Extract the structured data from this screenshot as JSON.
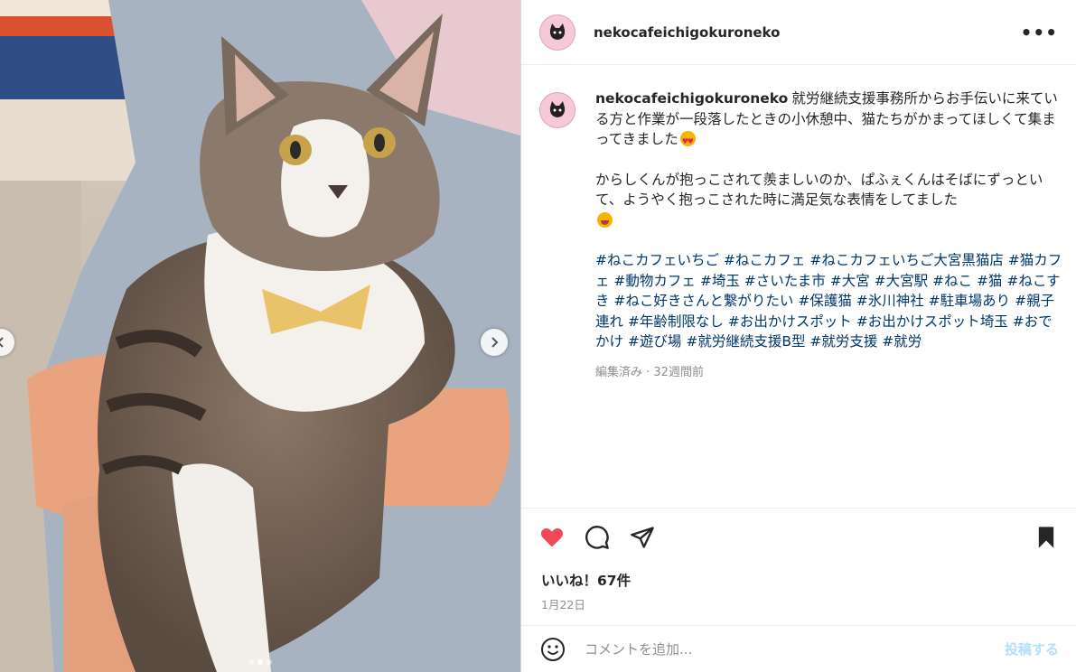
{
  "post": {
    "username": "nekocafeichigokuroneko",
    "more_icon": "more-horizontal-icon",
    "avatar_icon": "cat-cafe-logo"
  },
  "caption": {
    "username": "nekocafeichigokuroneko",
    "text1": "就労継続支援事務所からお手伝いに来ている方と作業が一段落したときの小休憩中、猫たちがかまってほしくて集まってきました",
    "text1_emoji": "heart-eyes-emoji",
    "text2": "からしくんが抱っこされて羨ましいのか、ぱふぇくんはそばにずっといて、ようやく抱っこされた時に満足気な表情をしてました",
    "text2_emoji": "grinning-squint-emoji",
    "hashtags": "#ねこカフェいちご #ねこカフェ #ねこカフェいちご大宮黒猫店 #猫カフェ #動物カフェ #埼玉 #さいたま市 #大宮 #大宮駅 #ねこ #猫 #ねこすき #ねこ好きさんと繋がりたい #保護猫 #氷川神社 #駐車場あり #親子連れ #年齢制限なし #お出かけスポット #お出かけスポット埼玉 #おでかけ #遊び場 #就労継続支援B型 #就労支援 #就労",
    "meta": "編集済み · 32週間前"
  },
  "actions": {
    "like_icon": "heart-filled-icon",
    "comment_icon": "comment-icon",
    "share_icon": "share-plane-icon",
    "save_icon": "bookmark-filled-icon",
    "like_color": "#ed4956"
  },
  "likes": "いいね！67件",
  "date": "1月22日",
  "comment_box": {
    "placeholder": "コメントを追加...",
    "post_label": "投稿する",
    "emoji_icon": "smiley-icon"
  },
  "carousel": {
    "prev_icon": "chevron-left-icon",
    "next_icon": "chevron-right-icon",
    "total": 3,
    "active": 2
  }
}
